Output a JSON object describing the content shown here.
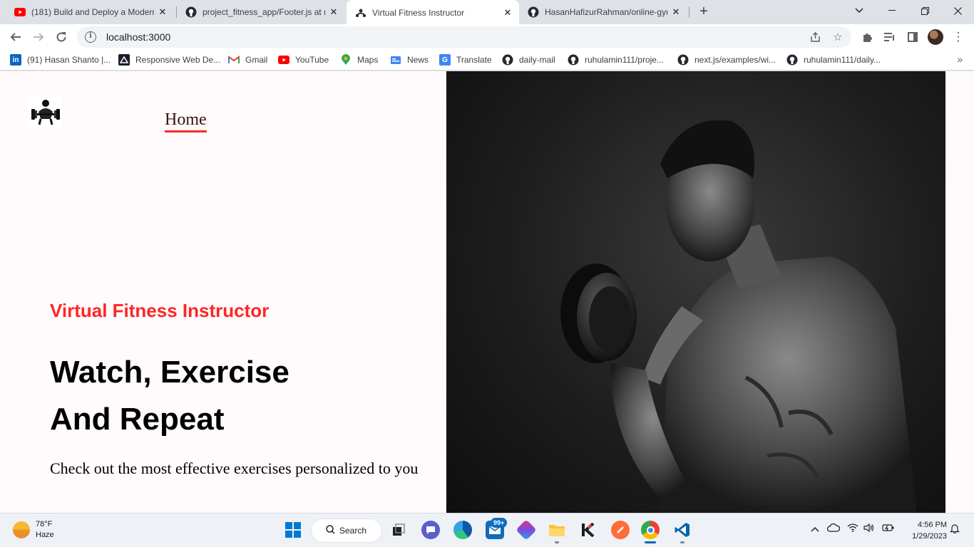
{
  "browser": {
    "tabs": [
      {
        "title": "(181) Build and Deploy a Modern",
        "icon": "youtube-icon",
        "active": false
      },
      {
        "title": "project_fitness_app/Footer.js at m",
        "icon": "github-icon",
        "active": false
      },
      {
        "title": "Virtual Fitness Instructor",
        "icon": "gym-logo-icon",
        "active": true
      },
      {
        "title": "HasanHafizurRahman/online-gym",
        "icon": "github-icon",
        "active": false
      }
    ],
    "address": "localhost:3000",
    "bookmarks": [
      {
        "label": "(91) Hasan Shanto |...",
        "icon": "linkedin-icon"
      },
      {
        "label": "Responsive Web De...",
        "icon": "responsive-web-icon"
      },
      {
        "label": "Gmail",
        "icon": "gmail-icon"
      },
      {
        "label": "YouTube",
        "icon": "youtube-icon"
      },
      {
        "label": "Maps",
        "icon": "maps-icon"
      },
      {
        "label": "News",
        "icon": "news-icon"
      },
      {
        "label": "Translate",
        "icon": "translate-icon"
      },
      {
        "label": "daily-mail",
        "icon": "github-icon"
      },
      {
        "label": "ruhulamin111/proje...",
        "icon": "github-icon"
      },
      {
        "label": "next.js/examples/wi...",
        "icon": "github-icon"
      },
      {
        "label": "ruhulamin111/daily...",
        "icon": "github-icon"
      }
    ]
  },
  "page": {
    "nav_home": "Home",
    "hero_subtitle": "Virtual Fitness Instructor",
    "hero_title_line1": "Watch, Exercise",
    "hero_title_line2": "And Repeat",
    "hero_description": "Check out the most effective exercises personalized to you",
    "accent_color": "#ff2625"
  },
  "taskbar": {
    "temperature": "78°F",
    "condition": "Haze",
    "search_label": "Search",
    "mail_badge": "99+",
    "time": "4:56 PM",
    "date": "1/29/2023"
  }
}
